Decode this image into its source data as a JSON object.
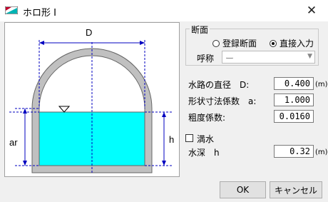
{
  "window": {
    "title": "ホロ形 I",
    "close_glyph": "✕"
  },
  "diagram": {
    "label_D": "D",
    "label_ar": "ar",
    "label_h": "h"
  },
  "section": {
    "group_label": "断面",
    "radio_registered": "登録断面",
    "radio_direct": "直接入力",
    "selected": "direct",
    "name_label": "呼称",
    "name_value": "ー"
  },
  "fields": {
    "diameter_label": "水路の直径　D:",
    "diameter_value": "0.400",
    "diameter_unit": "(m)",
    "shape_label": "形状寸法係数　a:",
    "shape_value": "1.000",
    "roughness_label": "粗度係数:",
    "roughness_value": "0.0160",
    "full_label": "満水",
    "full_checked": false,
    "depth_label": "水深　h",
    "depth_value": "0.32",
    "depth_unit": "(m)"
  },
  "buttons": {
    "ok": "OK",
    "cancel": "キャンセル"
  },
  "colors": {
    "water": "#00ffff",
    "wall": "#c0c0c0",
    "dimension": "#0000c0"
  }
}
